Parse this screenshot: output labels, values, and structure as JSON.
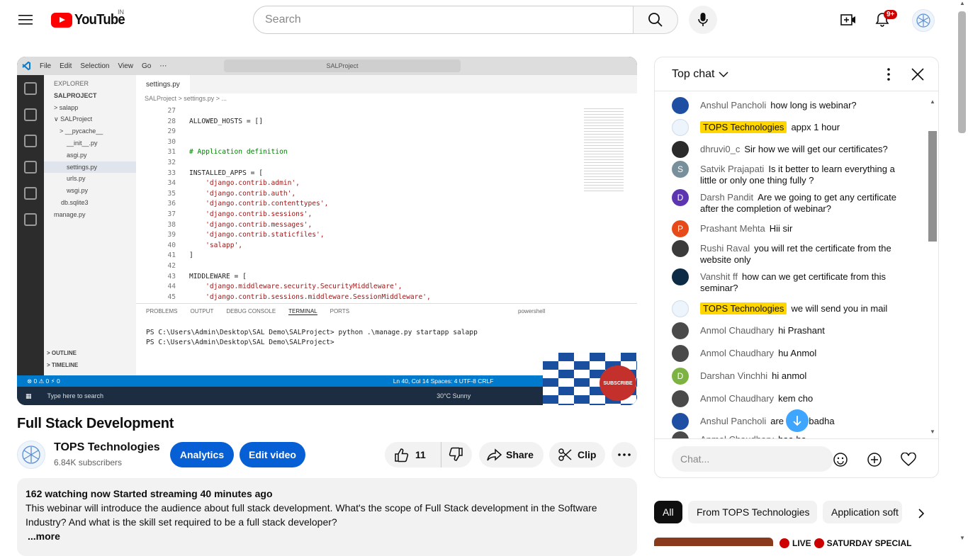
{
  "header": {
    "logo_text": "YouTube",
    "country_code": "IN",
    "search_placeholder": "Search",
    "notification_count": "9+"
  },
  "video": {
    "title": "Full Stack Development",
    "channel": "TOPS Technologies",
    "subscribers": "6.84K subscribers",
    "buttons": {
      "analytics": "Analytics",
      "edit": "Edit video",
      "likes": "11",
      "share": "Share",
      "clip": "Clip"
    },
    "description": {
      "stats": "162 watching now  Started streaming 40 minutes ago",
      "text": "This webinar will introduce the audience about full stack development. What's the scope of Full Stack development in the Software Industry? And what is the skill set required to be a full stack developer?",
      "more": "...more"
    },
    "screen": {
      "menu": [
        "File",
        "Edit",
        "Selection",
        "View",
        "Go",
        "⋯"
      ],
      "search": "SALProject",
      "explorer_title": "EXPLORER",
      "explorer_items": [
        "SALPROJECT",
        "> salapp",
        "∨ SALProject",
        "> __pycache__",
        "__init__.py",
        "asgi.py",
        "settings.py",
        "urls.py",
        "wsgi.py",
        "db.sqlite3",
        "manage.py"
      ],
      "outline": [
        "> OUTLINE",
        "> TIMELINE"
      ],
      "tab": "settings.py",
      "breadcrumb": "SALProject  >  settings.py  >  ...",
      "code_lines": [
        {
          "n": "27",
          "t": ""
        },
        {
          "n": "28",
          "t": "ALLOWED_HOSTS = []"
        },
        {
          "n": "29",
          "t": ""
        },
        {
          "n": "30",
          "t": ""
        },
        {
          "n": "31",
          "t": "# Application definition"
        },
        {
          "n": "32",
          "t": ""
        },
        {
          "n": "33",
          "t": "INSTALLED_APPS = ["
        },
        {
          "n": "34",
          "t": "    'django.contrib.admin',"
        },
        {
          "n": "35",
          "t": "    'django.contrib.auth',"
        },
        {
          "n": "36",
          "t": "    'django.contrib.contenttypes',"
        },
        {
          "n": "37",
          "t": "    'django.contrib.sessions',"
        },
        {
          "n": "38",
          "t": "    'django.contrib.messages',"
        },
        {
          "n": "39",
          "t": "    'django.contrib.staticfiles',"
        },
        {
          "n": "40",
          "t": "    'salapp',"
        },
        {
          "n": "41",
          "t": "]"
        },
        {
          "n": "42",
          "t": ""
        },
        {
          "n": "43",
          "t": "MIDDLEWARE = ["
        },
        {
          "n": "44",
          "t": "    'django.middleware.security.SecurityMiddleware',"
        },
        {
          "n": "45",
          "t": "    'django.contrib.sessions.middleware.SessionMiddleware',"
        }
      ],
      "terminal_tabs": [
        "PROBLEMS",
        "OUTPUT",
        "DEBUG CONSOLE",
        "TERMINAL",
        "PORTS"
      ],
      "terminal_shell": "powershell",
      "terminal_lines": [
        "PS C:\\Users\\Admin\\Desktop\\SAL Demo\\SALProject> python .\\manage.py startapp salapp",
        "PS C:\\Users\\Admin\\Desktop\\SAL Demo\\SALProject> "
      ],
      "status_left": "⊗ 0 ⚠ 0   ⚡ 0",
      "status_right": "Ln 40, Col 14    Spaces: 4    UTF-8    CRLF",
      "taskbar_search": "Type here to search",
      "weather": "30°C  Sunny",
      "subscribe": "SUBSCRIBE"
    }
  },
  "chat": {
    "title": "Top chat",
    "input_placeholder": "Chat...",
    "messages": [
      {
        "author": "Anshul Pancholi",
        "text": "how long is webinar?",
        "owner": false,
        "color": "#1e4fa3",
        "initial": ""
      },
      {
        "author": "TOPS Technologies",
        "text": "appx 1 hour",
        "owner": true,
        "color": "#eef4fb",
        "initial": ""
      },
      {
        "author": "dhruvi0_c",
        "text": "Sir how we will get our certificates?",
        "owner": false,
        "color": "#2b2b2b",
        "initial": ""
      },
      {
        "author": "Satvik Prajapati",
        "text": "Is it better to learn everything a little or only one thing fully ?",
        "owner": false,
        "color": "#78909c",
        "initial": "S"
      },
      {
        "author": "Darsh Pandit",
        "text": "Are we going to get any certificate after the completion of webinar?",
        "owner": false,
        "color": "#5e35b1",
        "initial": "D"
      },
      {
        "author": "Prashant Mehta",
        "text": "Hii sir",
        "owner": false,
        "color": "#e64a19",
        "initial": "P"
      },
      {
        "author": "Rushi Raval",
        "text": "you will ret the certificate from the website only",
        "owner": false,
        "color": "#3b3b3b",
        "initial": ""
      },
      {
        "author": "Vanshit ff",
        "text": "how can we get certificate from this seminar?",
        "owner": false,
        "color": "#0d2b45",
        "initial": ""
      },
      {
        "author": "TOPS Technologies",
        "text": "we will send you in mail",
        "owner": true,
        "color": "#eef4fb",
        "initial": ""
      },
      {
        "author": "Anmol Chaudhary",
        "text": "hi Prashant",
        "owner": false,
        "color": "#4a4a4a",
        "initial": ""
      },
      {
        "author": "Anmol Chaudhary",
        "text": "hu Anmol",
        "owner": false,
        "color": "#4a4a4a",
        "initial": ""
      },
      {
        "author": "Darshan Vinchhi",
        "text": "hi anmol",
        "owner": false,
        "color": "#7cb342",
        "initial": "D"
      },
      {
        "author": "Anmol Chaudhary",
        "text": "kem cho",
        "owner": false,
        "color": "#4a4a4a",
        "initial": ""
      },
      {
        "author": "Anshul Pancholi",
        "text": "are  gaya badha",
        "owner": false,
        "color": "#1e4fa3",
        "initial": ""
      },
      {
        "author": "Anmol Chaudhary",
        "text": "haa ha",
        "owner": false,
        "color": "#4a4a4a",
        "initial": ""
      }
    ]
  },
  "chips": [
    "All",
    "From TOPS Technologies",
    "Application soft"
  ],
  "suggested": {
    "live_label": "LIVE",
    "title_fragment": "SATURDAY SPECIAL"
  }
}
